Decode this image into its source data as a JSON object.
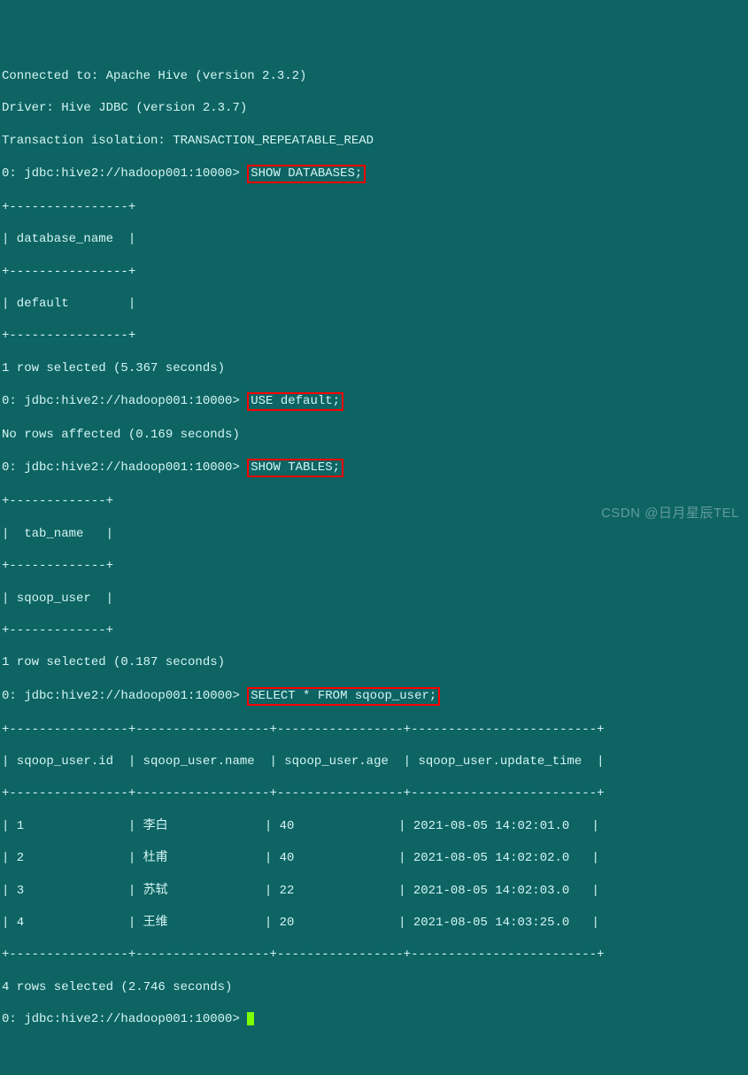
{
  "header": {
    "connected_to": "Connected to: Apache Hive (version 2.3.2)",
    "driver": "Driver: Hive JDBC (version 2.3.7)",
    "isolation": "Transaction isolation: TRANSACTION_REPEATABLE_READ"
  },
  "prompt": "0: jdbc:hive2://hadoop001:10000> ",
  "commands": {
    "show_databases": "SHOW DATABASES;",
    "use_default": "USE default;",
    "show_tables": "SHOW TABLES;",
    "select_sqoop": "SELECT * FROM sqoop_user;"
  },
  "db_table": {
    "border_top": "+----------------+",
    "header": "| database_name  |",
    "row": "| default        |",
    "result": "1 row selected (5.367 seconds)"
  },
  "use_result": "No rows affected (0.169 seconds)",
  "tab_table": {
    "border_top": "+-------------+",
    "header": "|  tab_name   |",
    "row": "| sqoop_user  |",
    "result": "1 row selected (0.187 seconds)"
  },
  "sqoop_table": {
    "border": "+----------------+------------------+-----------------+-------------------------+",
    "header": "| sqoop_user.id  | sqoop_user.name  | sqoop_user.age  | sqoop_user.update_time  |",
    "rows": [
      "| 1              | 李白             | 40              | 2021-08-05 14:02:01.0   |",
      "| 2              | 杜甫             | 40              | 2021-08-05 14:02:02.0   |",
      "| 3              | 苏轼             | 22              | 2021-08-05 14:02:03.0   |",
      "| 4              | 王维             | 20              | 2021-08-05 14:03:25.0   |"
    ],
    "result": "4 rows selected (2.746 seconds)"
  },
  "watermark": "CSDN @日月星辰TEL"
}
